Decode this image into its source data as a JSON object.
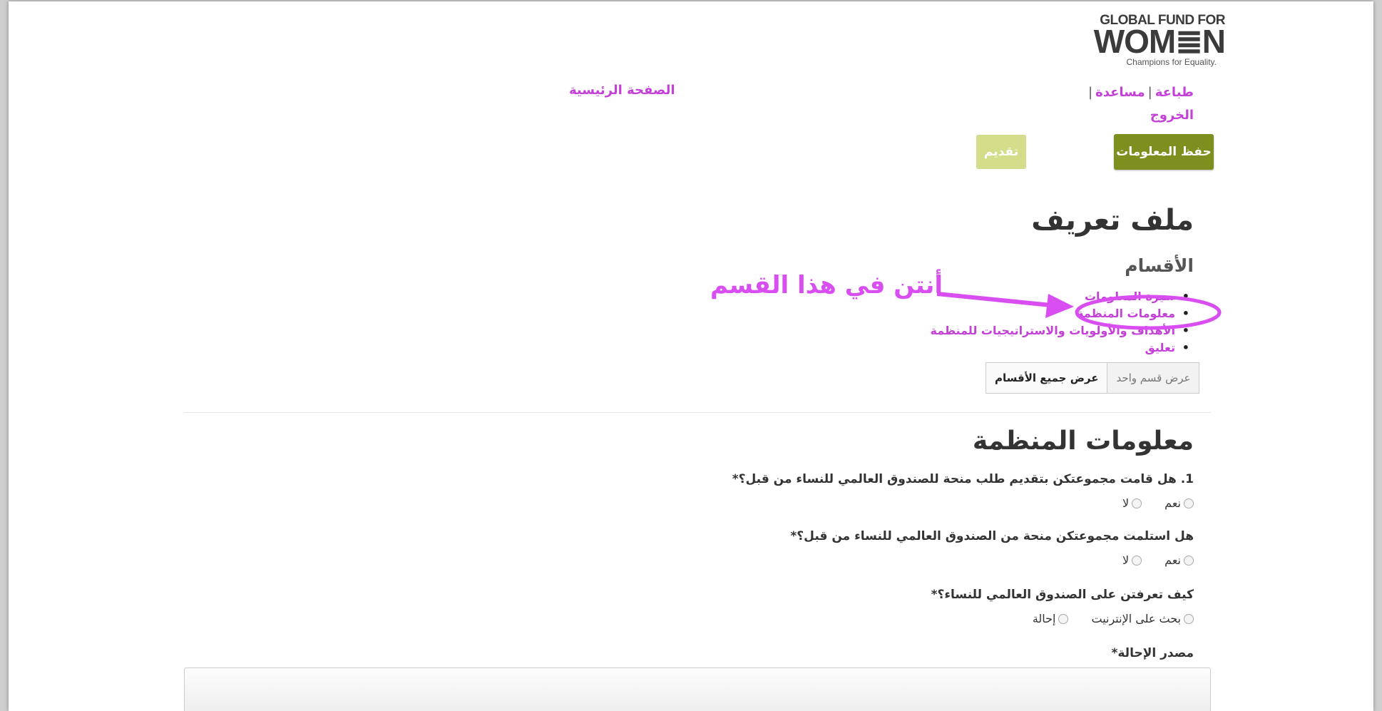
{
  "logo": {
    "line1": "GLOBAL FUND FOR",
    "line2": "WOM≣N",
    "tagline": "Champions for Equality."
  },
  "nav": {
    "print": "طباعة",
    "help": "مساعدة",
    "logout": "الخروج",
    "home": "الصفحة الرئيسية"
  },
  "buttons": {
    "save": "حفظ المعلومات",
    "submit": "تقديم"
  },
  "page_title": "ملف تعريف",
  "sections_title": "الأقسام",
  "sections": [
    "سيرة المعلومات",
    "معلومات المنظمة",
    "الأهداف والأولويات والاستراتيجيات للمنظمة",
    "تعليق"
  ],
  "annotation": {
    "text": "أنتن في هذا القسم",
    "color": "#d94ef0"
  },
  "view_toggle": {
    "one_section": "عرض قسم واحد",
    "all_sections": "عرض جميع الأقسام"
  },
  "section_heading": "معلومات المنظمة",
  "questions": [
    {
      "label": "1. هل قامت مجموعتكن بتقديم طلب منحة للصندوق العالمي للنساء من قبل؟*",
      "options": [
        "نعم",
        "لا"
      ]
    },
    {
      "label": "هل استلمت مجموعتكن منحة من الصندوق العالمي للنساء من قبل؟*",
      "options": [
        "نعم",
        "لا"
      ]
    },
    {
      "label": "كيف تعرفتن على الصندوق العالمي للنساء؟*",
      "options": [
        "بحث على الإنترنيت",
        "إحالة"
      ]
    },
    {
      "label": "مصدر الإحالة*"
    }
  ],
  "colors": {
    "accent_link": "#c341d6",
    "save_button": "#7f8f1f",
    "submit_button": "#d4dd8a"
  }
}
